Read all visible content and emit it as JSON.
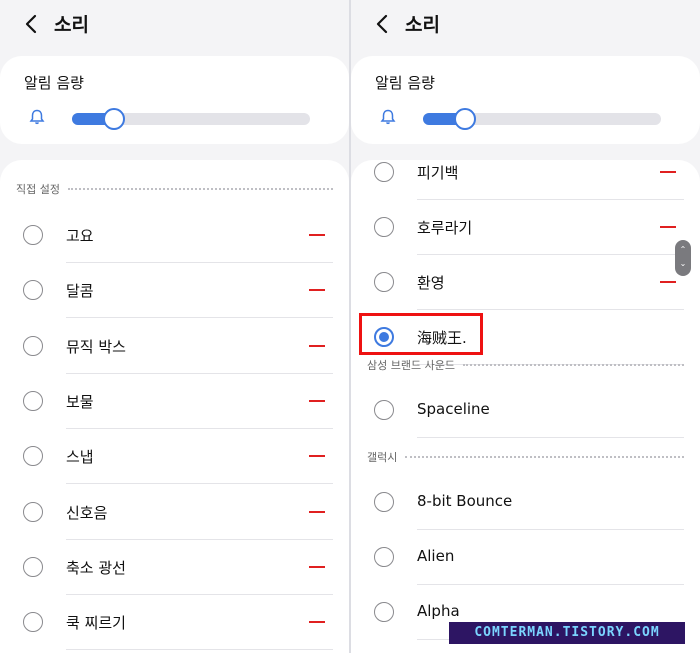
{
  "header": {
    "title": "소리"
  },
  "volume": {
    "label": "알림 음량",
    "level_percent": 13
  },
  "left_list": {
    "section_label": "직접 설정",
    "items": [
      {
        "label": "고요"
      },
      {
        "label": "달콤"
      },
      {
        "label": "뮤직 박스"
      },
      {
        "label": "보물"
      },
      {
        "label": "스냅"
      },
      {
        "label": "신호음"
      },
      {
        "label": "축소 광선"
      },
      {
        "label": "쿡 찌르기"
      }
    ]
  },
  "right_list": {
    "custom_items": [
      {
        "label": "피기백"
      },
      {
        "label": "호루라기"
      },
      {
        "label": "환영"
      },
      {
        "label": "海贼王."
      }
    ],
    "samsung_section_label": "삼성 브랜드 사운드",
    "samsung_items": [
      {
        "label": "Spaceline"
      }
    ],
    "galaxy_section_label": "갤럭시",
    "galaxy_items": [
      {
        "label": "8-bit Bounce"
      },
      {
        "label": "Alien"
      },
      {
        "label": "Alpha"
      }
    ]
  },
  "selected": "海贼王.",
  "watermark": "COMTERMAN.TISTORY.COM",
  "colors": {
    "accent": "#3e7ae0",
    "delete": "#e02020",
    "highlight": "#ee1111"
  },
  "icons": {
    "back": "chevron-left-icon",
    "bell": "bell-icon",
    "remove": "minus-icon"
  }
}
